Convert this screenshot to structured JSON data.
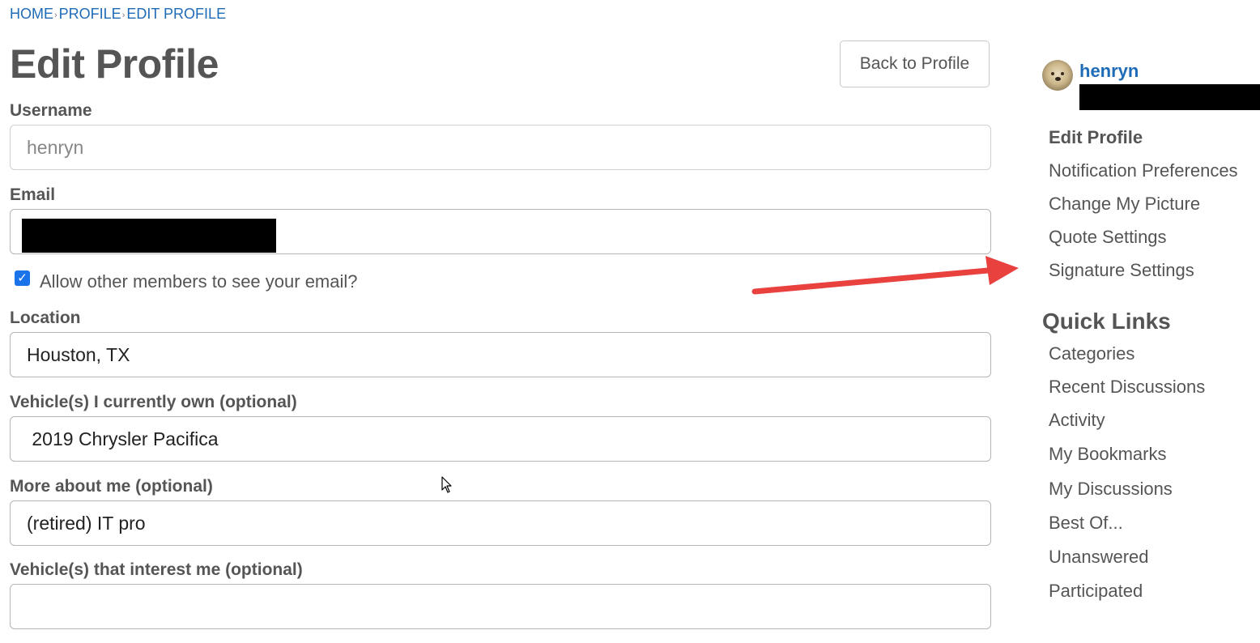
{
  "breadcrumb": {
    "items": [
      "HOME",
      "PROFILE",
      "EDIT PROFILE"
    ],
    "separator": "›"
  },
  "page": {
    "title": "Edit Profile",
    "back_button": "Back to Profile"
  },
  "form": {
    "username": {
      "label": "Username",
      "value": "henryn"
    },
    "email": {
      "label": "Email",
      "value": ""
    },
    "show_email": {
      "label": "Allow other members to see your email?",
      "checked": true
    },
    "location": {
      "label": "Location",
      "value": "Houston, TX"
    },
    "vehicles_owned": {
      "label": "Vehicle(s) I currently own (optional)",
      "value": " 2019 Chrysler Pacifica"
    },
    "about": {
      "label": "More about me (optional)",
      "value": "(retired) IT pro"
    },
    "vehicles_interest": {
      "label": "Vehicle(s) that interest me (optional)",
      "value": ""
    }
  },
  "sidebar": {
    "username": "henryn",
    "profile_links": [
      "Edit Profile",
      "Notification Preferences",
      "Change My Picture",
      "Quote Settings",
      "Signature Settings"
    ],
    "quick_links_heading": "Quick Links",
    "quick_links": [
      "Categories",
      "Recent Discussions",
      "Activity",
      "My Bookmarks",
      "My Discussions",
      "Best Of...",
      "Unanswered",
      "Participated"
    ]
  },
  "colors": {
    "link": "#1e6bb8",
    "text": "#555555",
    "annotation_arrow": "#e8413e",
    "checkbox": "#1a73e8"
  },
  "icons": [
    "check-icon",
    "avatar-image",
    "annotation-arrow",
    "mouse-cursor-icon"
  ]
}
